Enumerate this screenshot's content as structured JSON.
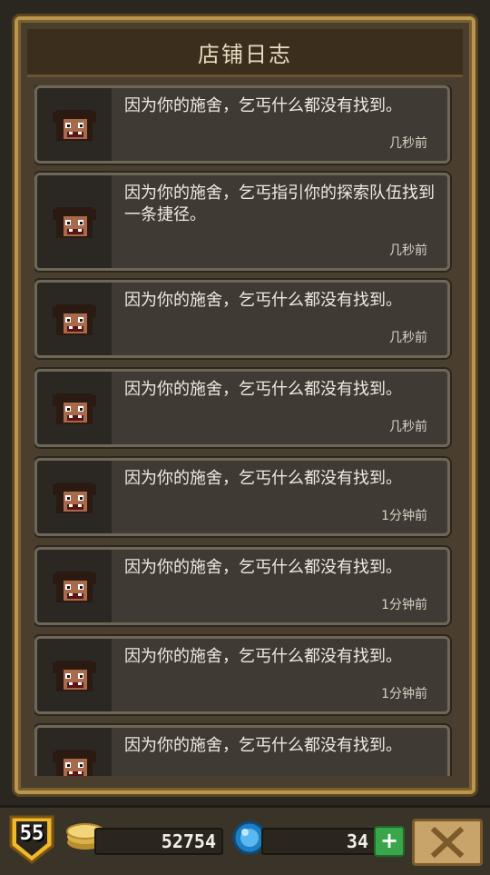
{
  "panel": {
    "title": "店铺日志"
  },
  "entries": [
    {
      "message": "因为你的施舍，乞丐什么都没有找到。",
      "time": "几秒前"
    },
    {
      "message": "因为你的施舍，乞丐指引你的探索队伍找到一条捷径。",
      "time": "几秒前"
    },
    {
      "message": "因为你的施舍，乞丐什么都没有找到。",
      "time": "几秒前"
    },
    {
      "message": "因为你的施舍，乞丐什么都没有找到。",
      "time": "几秒前"
    },
    {
      "message": "因为你的施舍，乞丐什么都没有找到。",
      "time": "1分钟前"
    },
    {
      "message": "因为你的施舍，乞丐什么都没有找到。",
      "time": "1分钟前"
    },
    {
      "message": "因为你的施舍，乞丐什么都没有找到。",
      "time": "1分钟前"
    },
    {
      "message": "因为你的施舍，乞丐什么都没有找到。",
      "time": ""
    }
  ],
  "footer": {
    "level": "55",
    "coins": "52754",
    "gems": "34",
    "plus_label": "+",
    "icons": {
      "coin": "coin-stack-icon",
      "gem": "blue-gem-icon",
      "close": "close-x-icon",
      "level": "level-shield-icon"
    }
  },
  "colors": {
    "accent_gold": "#b8964e",
    "plus_green": "#3aa54a"
  }
}
